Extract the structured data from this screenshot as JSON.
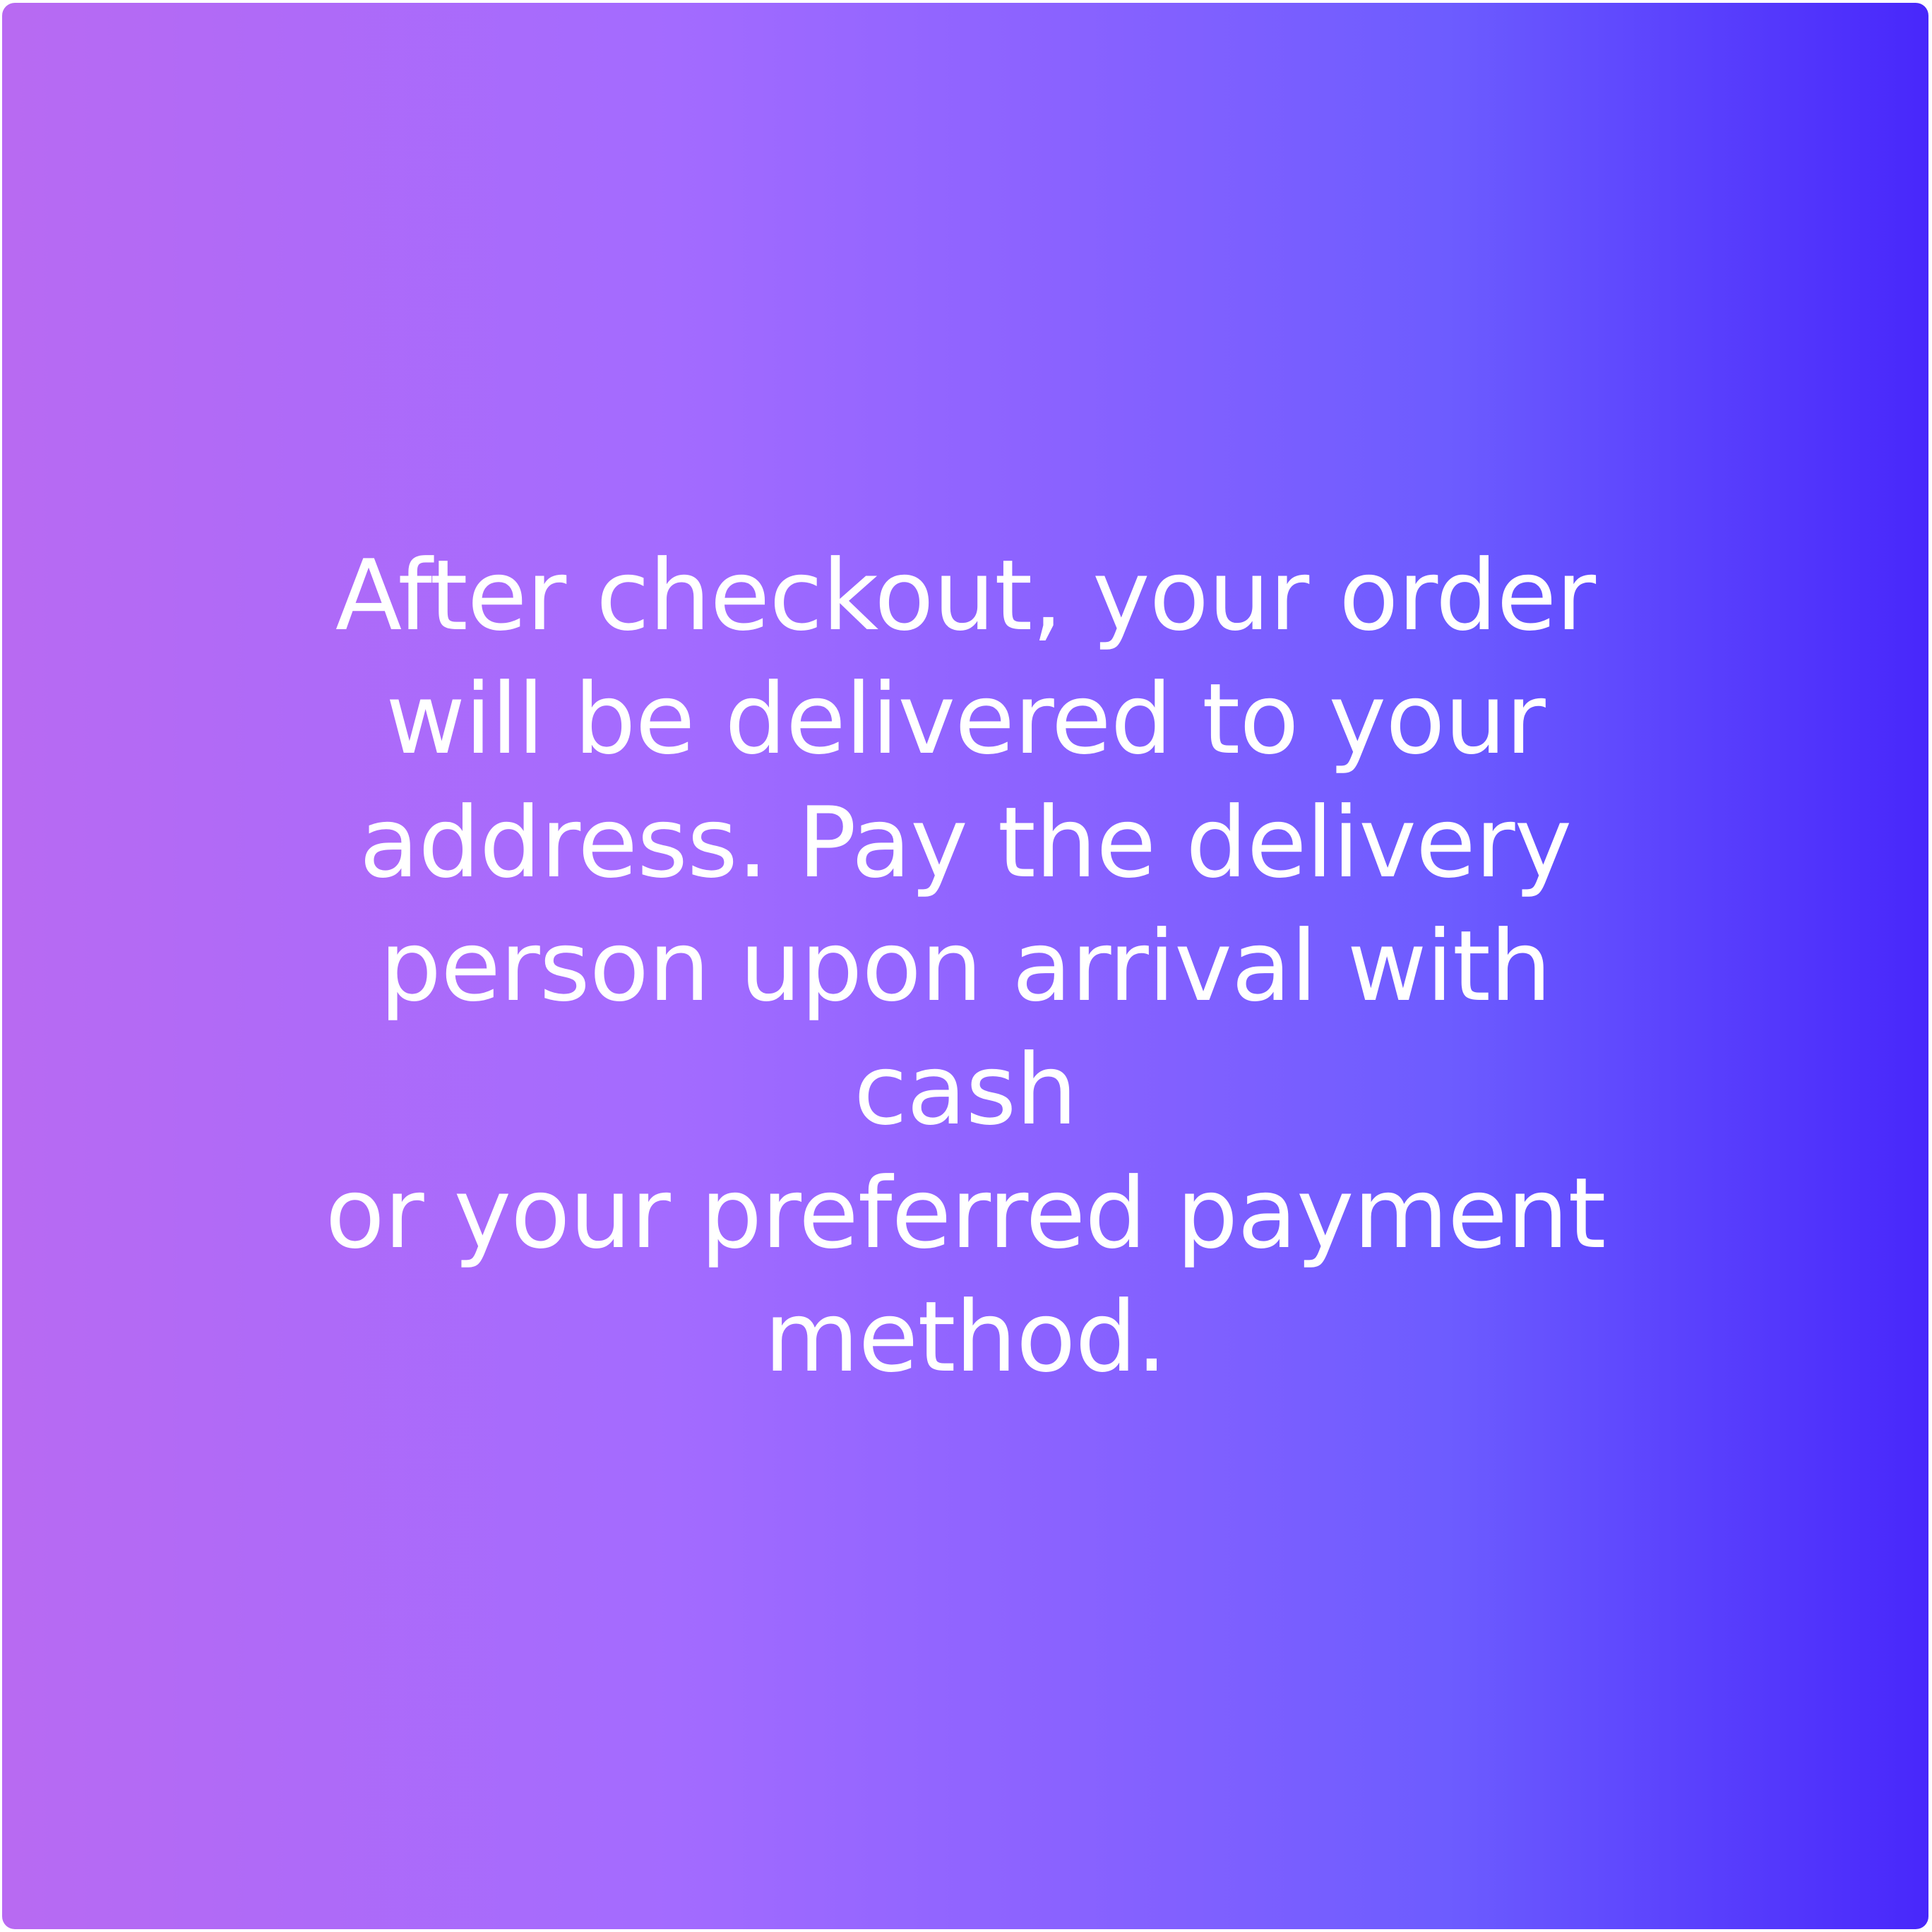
{
  "card": {
    "message": "After checkout, your order\nwill be delivered to your\naddress. Pay the delivery\nperson upon arrival with cash\nor your preferred payment\nmethod."
  },
  "colors": {
    "gradient_start": "#b86af2",
    "gradient_end": "#4827fb",
    "text": "#ffffff"
  }
}
